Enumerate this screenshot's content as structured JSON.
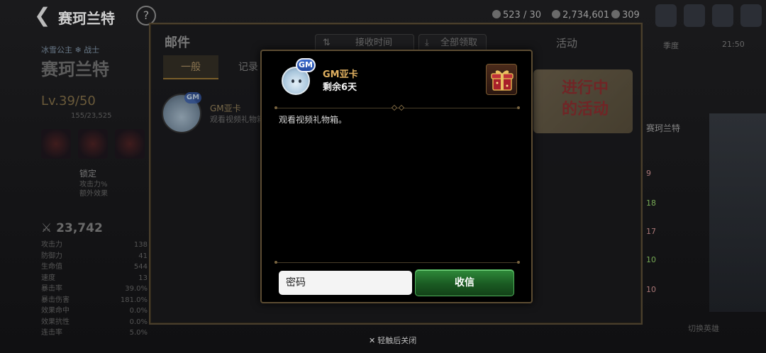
{
  "header": {
    "title": "赛珂兰特",
    "help": "?",
    "resources": [
      "523 / 30",
      "2,734,601",
      "309"
    ]
  },
  "hero_panel": {
    "subtitle": "冰雪公主  ❄ 战士",
    "name": "赛珂兰特",
    "level": "Lv.39/50",
    "exp": "155/23,525",
    "lock_title": "锁定",
    "lock_desc_1": "攻击力%",
    "lock_desc_2": "额外效果",
    "combat_power": "23,742",
    "stats": [
      {
        "label": "攻击力",
        "value": "138"
      },
      {
        "label": "防御力",
        "value": "41"
      },
      {
        "label": "生命值",
        "value": "544"
      },
      {
        "label": "速度",
        "value": "13"
      },
      {
        "label": "暴击率",
        "value": "39.0%"
      },
      {
        "label": "暴击伤害",
        "value": "181.0%"
      },
      {
        "label": "效果命中",
        "value": "0.0%"
      },
      {
        "label": "效果抗性",
        "value": "0.0%"
      },
      {
        "label": "连击率",
        "value": "5.0%"
      }
    ]
  },
  "side_panel": {
    "date": "季度",
    "time": "21:50",
    "name": "赛珂兰特",
    "rows": [
      "9",
      "18",
      "17",
      "10",
      "10"
    ],
    "footer": "切换英雄"
  },
  "mail": {
    "title": "邮件",
    "tabs": {
      "general": "一般",
      "record": "记录"
    },
    "sort_label": "接收时间",
    "claim_all_label": "全部领取",
    "activity_label": "活动",
    "banner_text_1": "进行中",
    "banner_text_2": "的活动",
    "items": [
      {
        "sender": "GM亚卡",
        "preview": "观看视频礼物箱。"
      }
    ]
  },
  "modal": {
    "badge": "GM",
    "sender": "GM亚卡",
    "remaining": "剩余6天",
    "body": "观看视频礼物箱。",
    "password_placeholder": "密码",
    "receive_label": "收信"
  },
  "close_hint": "轻触后关闭",
  "colors": {
    "gold_border": "#5c4c32",
    "sender_gold": "#e0b060",
    "button_green": "#2f8a3a",
    "gm_badge_blue": "#244aa0"
  }
}
